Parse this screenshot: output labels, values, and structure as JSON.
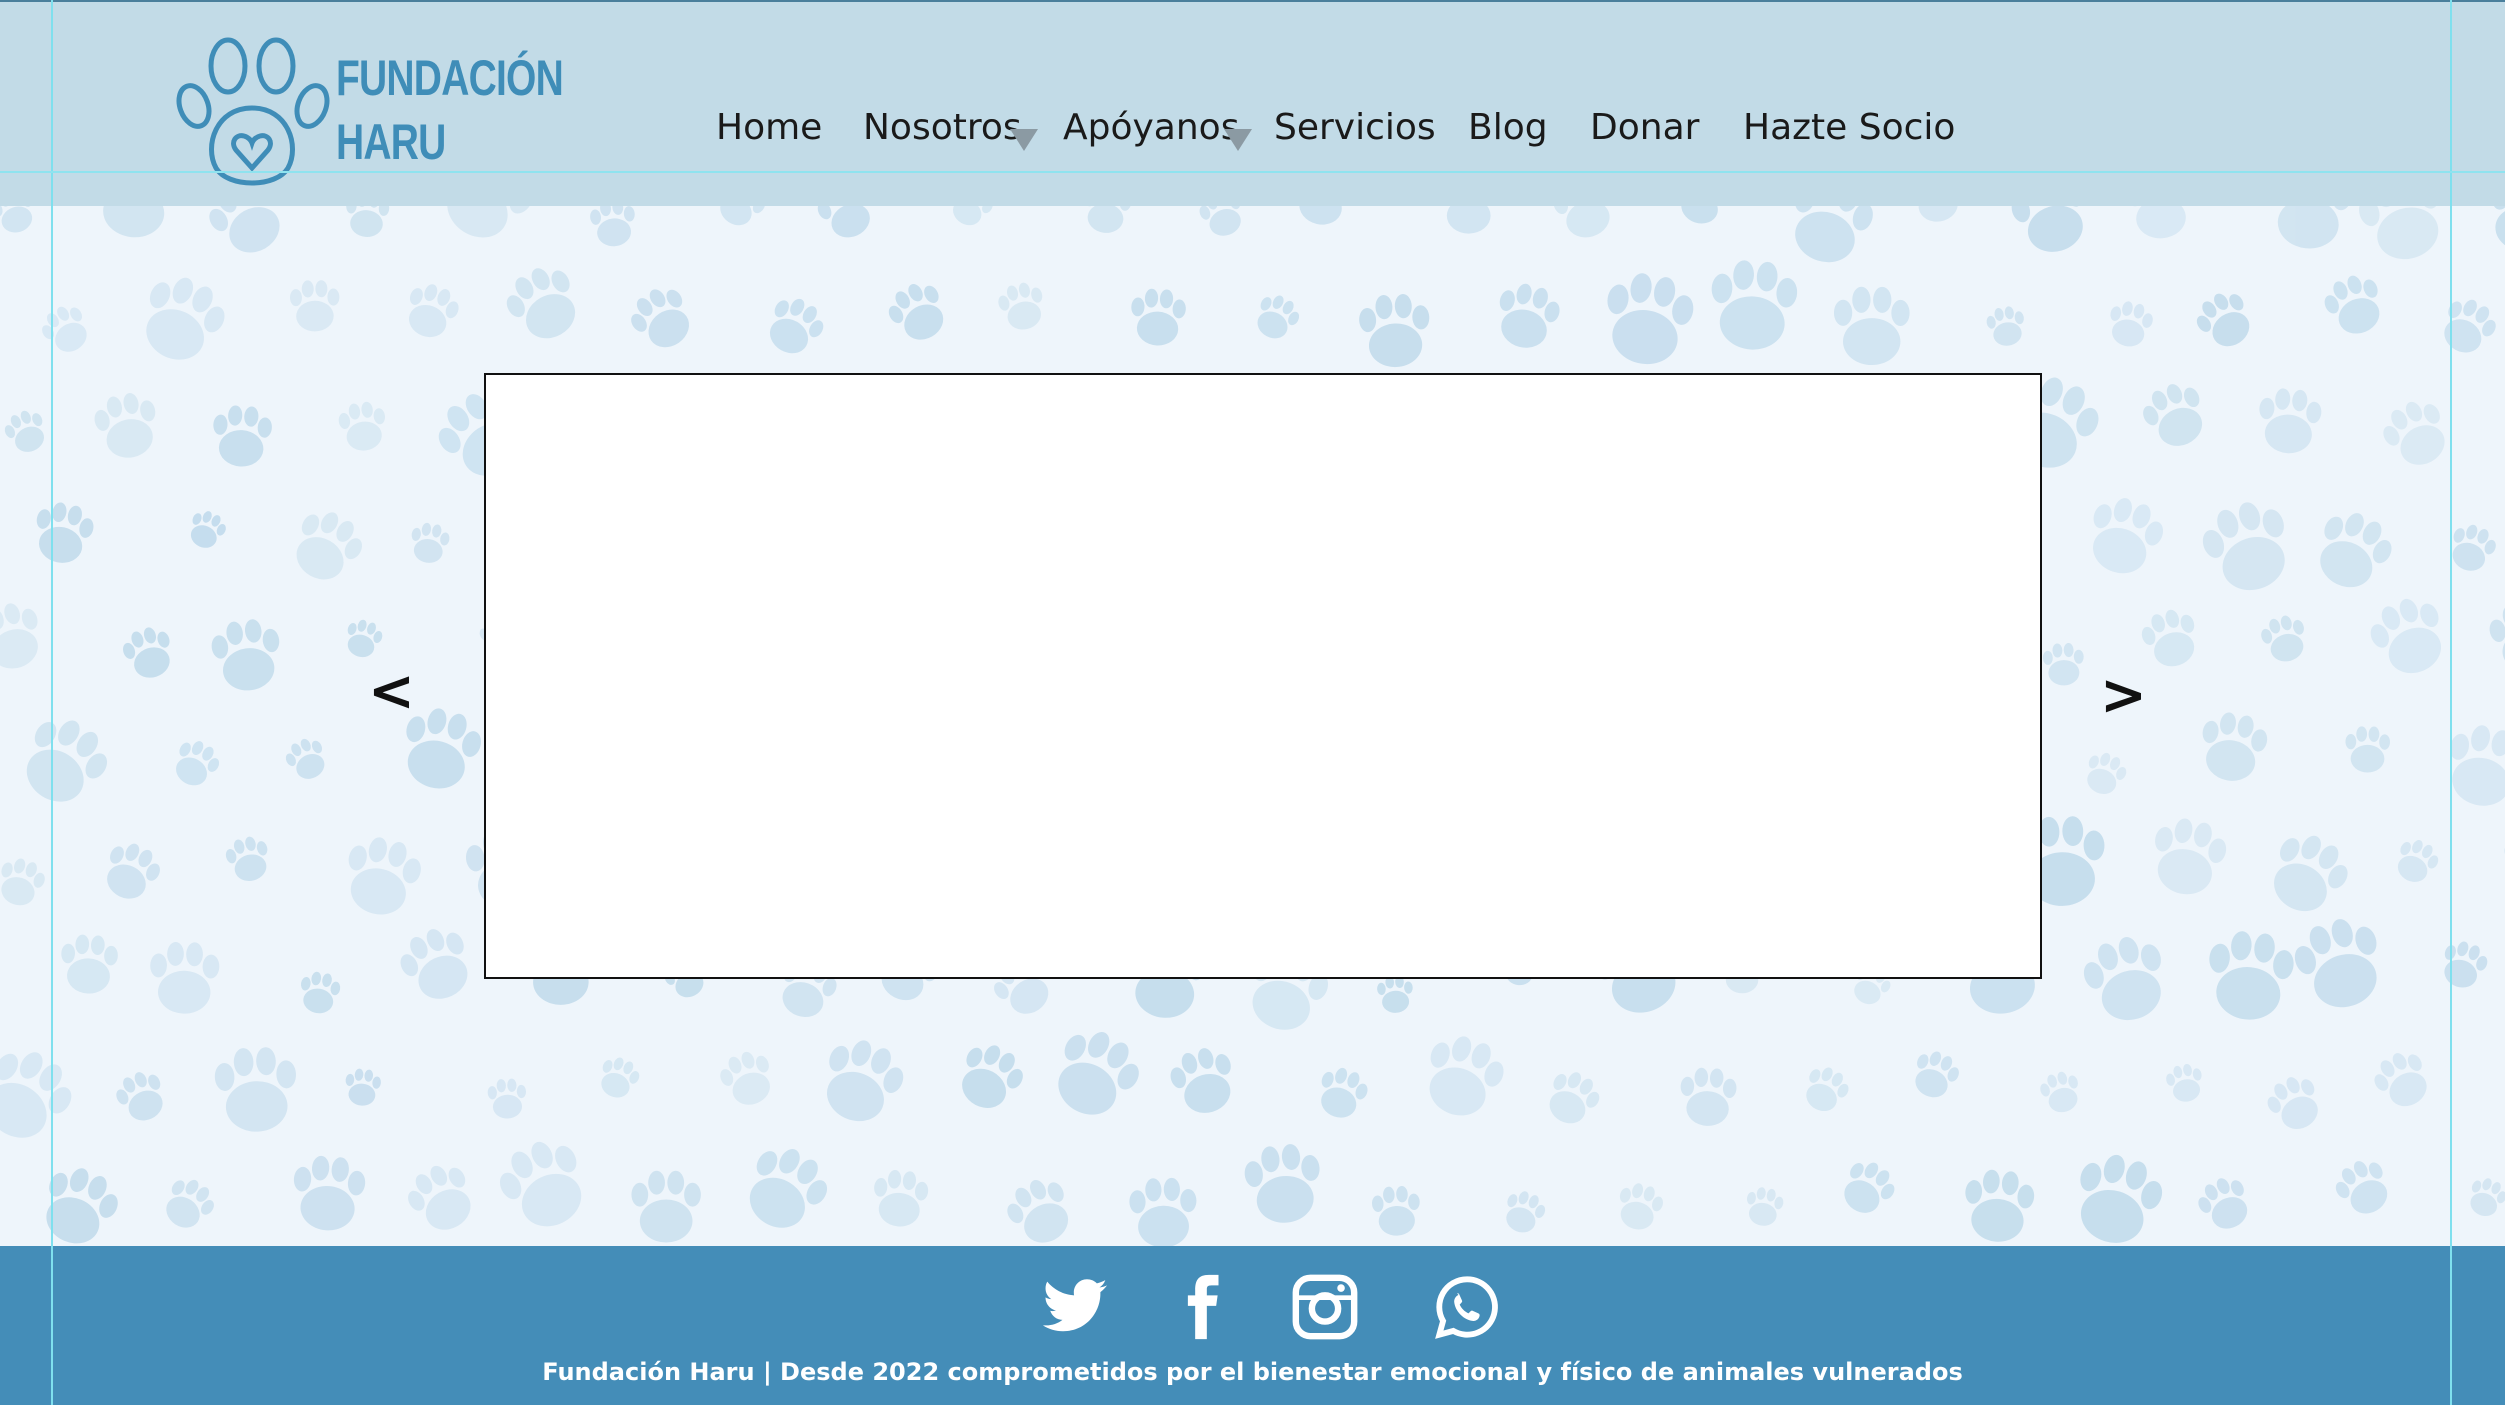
{
  "header": {
    "logo": {
      "line1": "FUNDACIÓN",
      "line2": "HARU",
      "icon": "paw-heart-icon"
    },
    "nav": {
      "home": "Home",
      "nosotros": "Nosotros",
      "apoyanos": "Apóyanos",
      "servicios": "Servicios",
      "blog": "Blog",
      "donar": "Donar",
      "socio": "Hazte Socio"
    }
  },
  "carousel": {
    "prev": "<",
    "next": ">"
  },
  "footer": {
    "social": [
      "twitter-icon",
      "facebook-icon",
      "instagram-icon",
      "whatsapp-icon"
    ],
    "text": "Fundación Haru | Desde 2022 comprometidos por el bienestar emocional y físico de animales vulnerados"
  },
  "colors": {
    "header_bg": "#c2dbe7",
    "brand_blue": "#3f8db8",
    "footer_bg": "#448db8",
    "paw_pattern": "#bcd8ea",
    "page_bg": "#eef5fb"
  }
}
